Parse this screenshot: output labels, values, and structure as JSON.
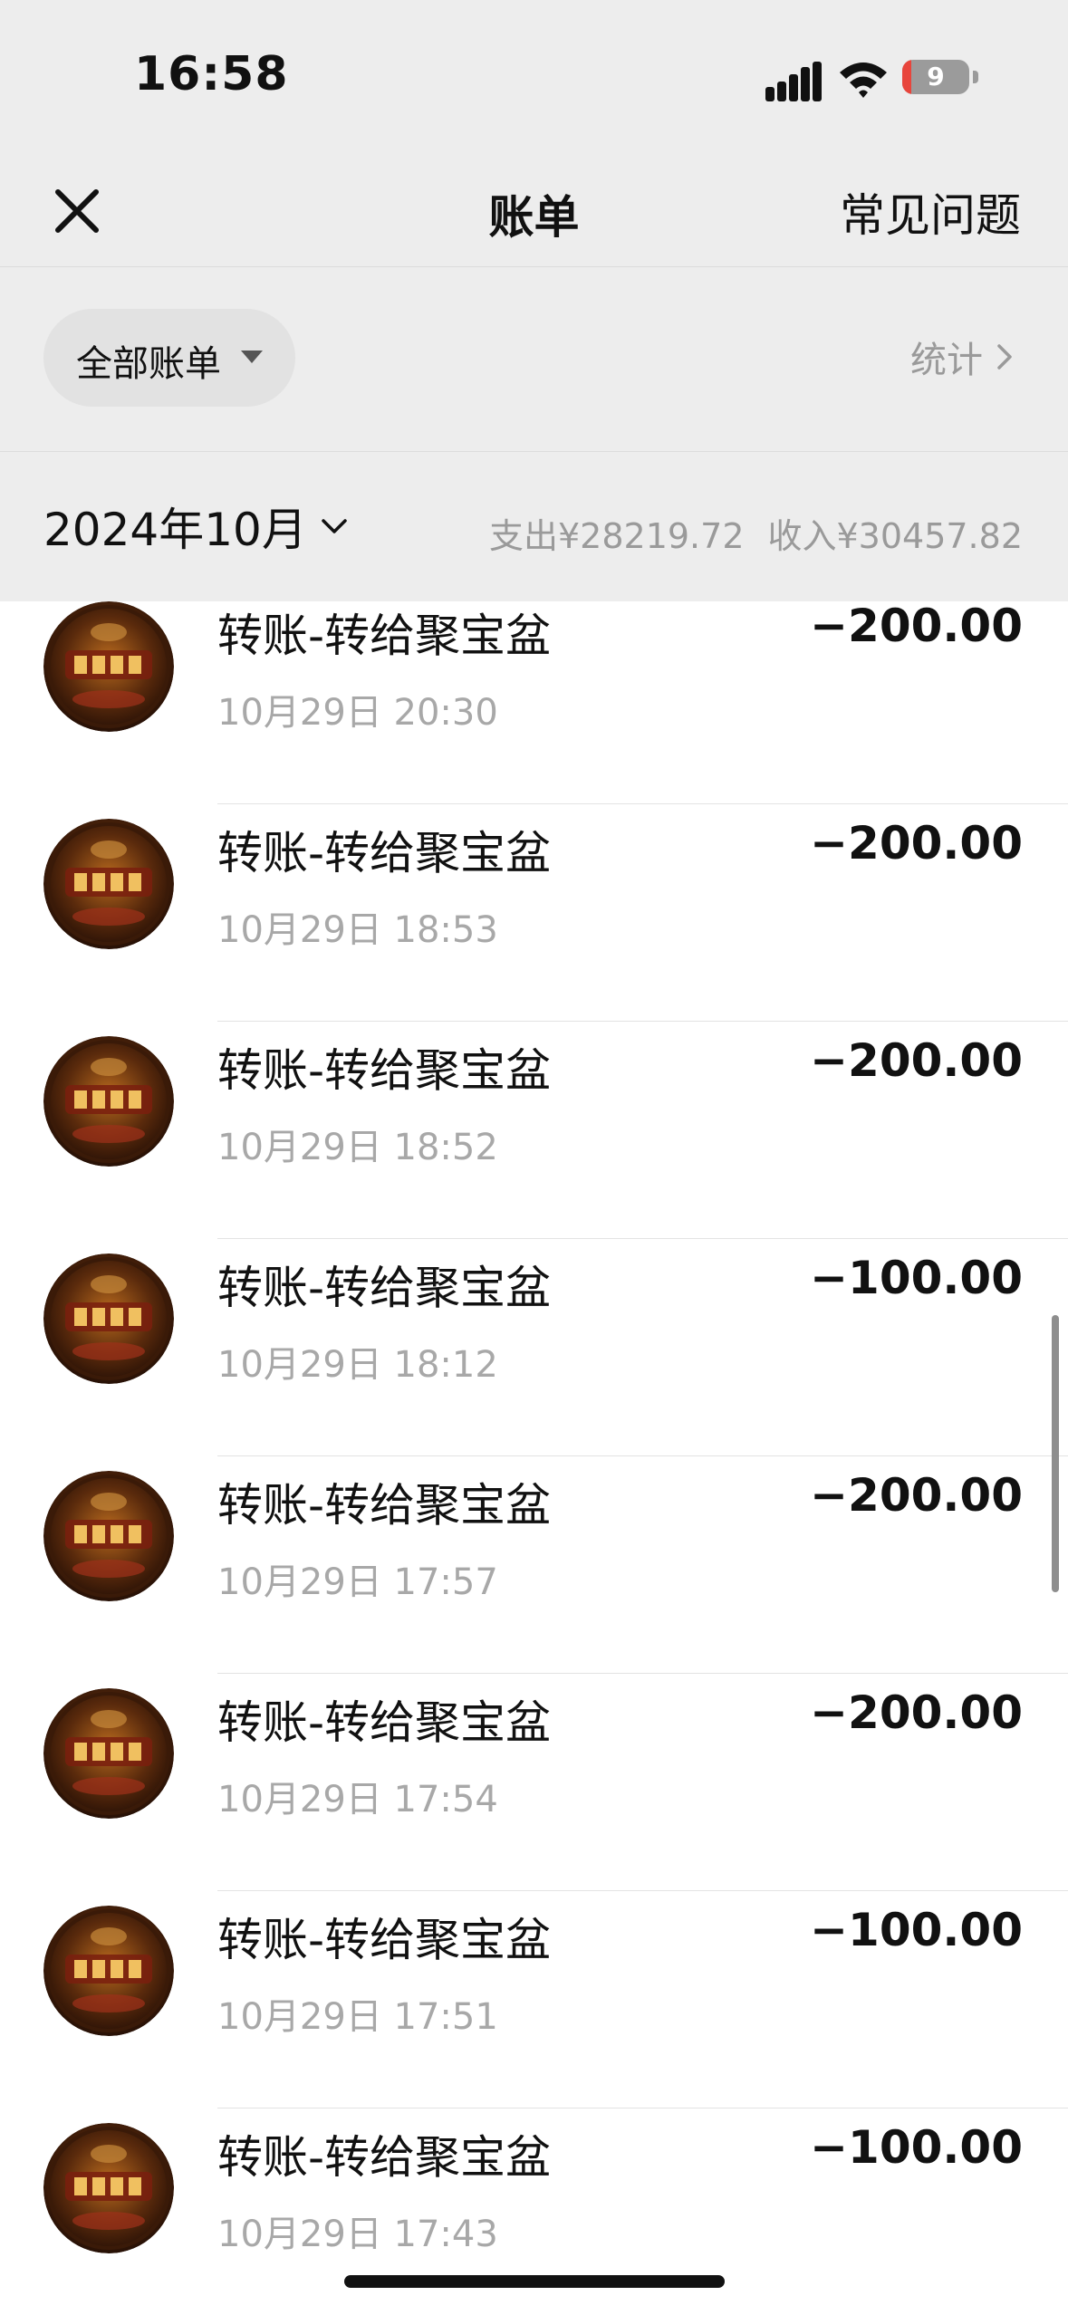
{
  "status_bar": {
    "time": "16:58",
    "battery_level": "9",
    "icons": [
      "cellular-signal-icon",
      "wifi-icon",
      "battery-icon"
    ]
  },
  "nav": {
    "close_icon": "close-icon",
    "title": "账单",
    "faq_label": "常见问题"
  },
  "filter": {
    "label": "全部账单",
    "caret_icon": "caret-down-icon",
    "stats_label": "统计",
    "stats_icon": "chevron-right-icon"
  },
  "month": {
    "label": "2024年10月",
    "chevron_icon": "chevron-down-icon",
    "expense": "支出¥28219.72",
    "income": "收入¥30457.82"
  },
  "transactions": [
    {
      "title": "转账-转给聚宝盆",
      "time": "10月29日 20:30",
      "amount": "−200.00"
    },
    {
      "title": "转账-转给聚宝盆",
      "time": "10月29日 18:53",
      "amount": "−200.00"
    },
    {
      "title": "转账-转给聚宝盆",
      "time": "10月29日 18:52",
      "amount": "−200.00"
    },
    {
      "title": "转账-转给聚宝盆",
      "time": "10月29日 18:12",
      "amount": "−100.00"
    },
    {
      "title": "转账-转给聚宝盆",
      "time": "10月29日 17:57",
      "amount": "−200.00"
    },
    {
      "title": "转账-转给聚宝盆",
      "time": "10月29日 17:54",
      "amount": "−200.00"
    },
    {
      "title": "转账-转给聚宝盆",
      "time": "10月29日 17:51",
      "amount": "−100.00"
    },
    {
      "title": "转账-转给聚宝盆",
      "time": "10月29日 17:43",
      "amount": "−100.00"
    }
  ],
  "colors": {
    "header_bg": "#ededed",
    "list_bg": "#ffffff",
    "secondary_text": "#9a9a9a",
    "battery_low": "#e8453c"
  }
}
